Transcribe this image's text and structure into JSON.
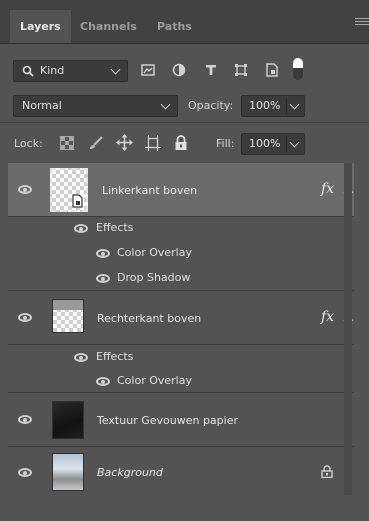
{
  "tabs": [
    {
      "label": "Layers",
      "active": true
    },
    {
      "label": "Channels",
      "active": false
    },
    {
      "label": "Paths",
      "active": false
    }
  ],
  "filter": {
    "kind_label": "Kind",
    "icons": [
      "image-filter-icon",
      "adjustment-filter-icon",
      "type-filter-icon",
      "shape-filter-icon",
      "smart-object-filter-icon",
      "filter-toggle-icon"
    ]
  },
  "blend": {
    "mode": "Normal",
    "opacity_label": "Opacity:",
    "opacity_value": "100%"
  },
  "lock": {
    "label": "Lock:",
    "icons": [
      "lock-transparent-pixels-icon",
      "lock-image-pixels-icon",
      "lock-position-icon",
      "lock-artboard-icon",
      "lock-all-icon"
    ],
    "fill_label": "Fill:",
    "fill_value": "100%"
  },
  "layers": [
    {
      "name": "Linkerkant boven",
      "selected": true,
      "has_fx": true,
      "effects_label": "Effects",
      "effects": [
        "Color Overlay",
        "Drop Shadow"
      ]
    },
    {
      "name": "Rechterkant boven",
      "selected": false,
      "has_fx": true,
      "effects_label": "Effects",
      "effects": [
        "Color Overlay"
      ]
    },
    {
      "name": "Textuur Gevouwen papier",
      "selected": false,
      "has_fx": false
    },
    {
      "name": "Background",
      "selected": false,
      "has_fx": false,
      "locked": true
    }
  ],
  "fx_symbol": "fx",
  "colors": {
    "panel_bg": "#535353",
    "tab_bg": "#424242",
    "selected_row": "#6b6b6b",
    "field_bg": "#3b3b3b"
  }
}
